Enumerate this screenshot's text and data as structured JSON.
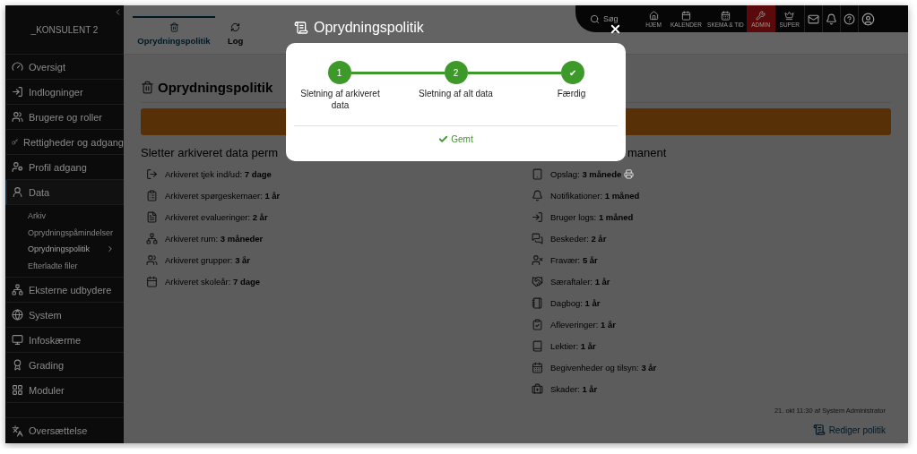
{
  "sidebar": {
    "account": "_KONSULENT 2",
    "items": [
      {
        "label": "Oversigt",
        "selected": false
      },
      {
        "label": "Indlogninger",
        "selected": false
      },
      {
        "label": "Brugere og roller",
        "selected": false
      },
      {
        "label": "Rettigheder og adgang",
        "selected": false
      },
      {
        "label": "Profil adgang",
        "selected": false
      },
      {
        "label": "Data",
        "selected": true,
        "children": [
          {
            "label": "Arkiv",
            "selected": false
          },
          {
            "label": "Oprydningspåmindelser",
            "selected": false
          },
          {
            "label": "Oprydningspolitik",
            "selected": true
          },
          {
            "label": "Efterladte filer",
            "selected": false
          }
        ]
      },
      {
        "label": "Eksterne udbydere",
        "selected": false
      },
      {
        "label": "System",
        "selected": false
      },
      {
        "label": "Infoskærme",
        "selected": false
      },
      {
        "label": "Grading",
        "selected": false
      },
      {
        "label": "Moduler",
        "selected": false
      }
    ],
    "footer_item": "Oversættelse"
  },
  "topbar": {
    "search": {
      "placeholder": "Søg"
    },
    "nav": [
      {
        "label": "HJEM",
        "selected": false
      },
      {
        "label": "KALENDER",
        "selected": false
      },
      {
        "label": "SKEMA & TID",
        "selected": false
      },
      {
        "label": "ADMIN",
        "selected": true
      },
      {
        "label": "SUPER",
        "selected": false
      }
    ]
  },
  "tabs": [
    {
      "label": "Oprydningspolitik",
      "selected": true
    },
    {
      "label": "Log",
      "selected": false
    }
  ],
  "page": {
    "title": "Oprydningspolitik",
    "left": {
      "heading": "Sletter arkiveret data perm",
      "items": [
        {
          "label": "Arkiveret tjek ind/ud:",
          "value": "7 dage"
        },
        {
          "label": "Arkiveret spørgeskemaer:",
          "value": "1 år"
        },
        {
          "label": "Arkiveret evalueringer:",
          "value": "2 år"
        },
        {
          "label": "Arkiveret rum:",
          "value": "3 måneder"
        },
        {
          "label": "Arkiveret grupper:",
          "value": "3 år"
        },
        {
          "label": "Arkiveret skoleår:",
          "value": "7 dage"
        }
      ]
    },
    "right": {
      "heading": "manent",
      "items": [
        {
          "label": "Opslag:",
          "value": "3 månede"
        },
        {
          "label": "Notifikationer:",
          "value": "1 måned"
        },
        {
          "label": "Bruger logs:",
          "value": "1 måned"
        },
        {
          "label": "Beskeder:",
          "value": "2 år"
        },
        {
          "label": "Fravær:",
          "value": "5 år"
        },
        {
          "label": "Særaftaler:",
          "value": "1 år"
        },
        {
          "label": "Dagbog:",
          "value": "1 år"
        },
        {
          "label": "Afleveringer:",
          "value": "1 år"
        },
        {
          "label": "Lektier:",
          "value": "1 år"
        },
        {
          "label": "Begivenheder og tilsyn:",
          "value": "3 år"
        },
        {
          "label": "Skader:",
          "value": "1 år"
        }
      ]
    },
    "updated": "21. okt 11:30 af System Administrator",
    "edit_link": "Rediger politik"
  },
  "modal": {
    "title": "Oprydningspolitik",
    "steps": [
      {
        "marker": "1",
        "label": "Sletning af arkiveret data",
        "done": true
      },
      {
        "marker": "2",
        "label": "Sletning af alt data",
        "done": true
      },
      {
        "marker": "✔",
        "label": "Færdig",
        "done": true
      }
    ],
    "status": "Gemt"
  }
}
